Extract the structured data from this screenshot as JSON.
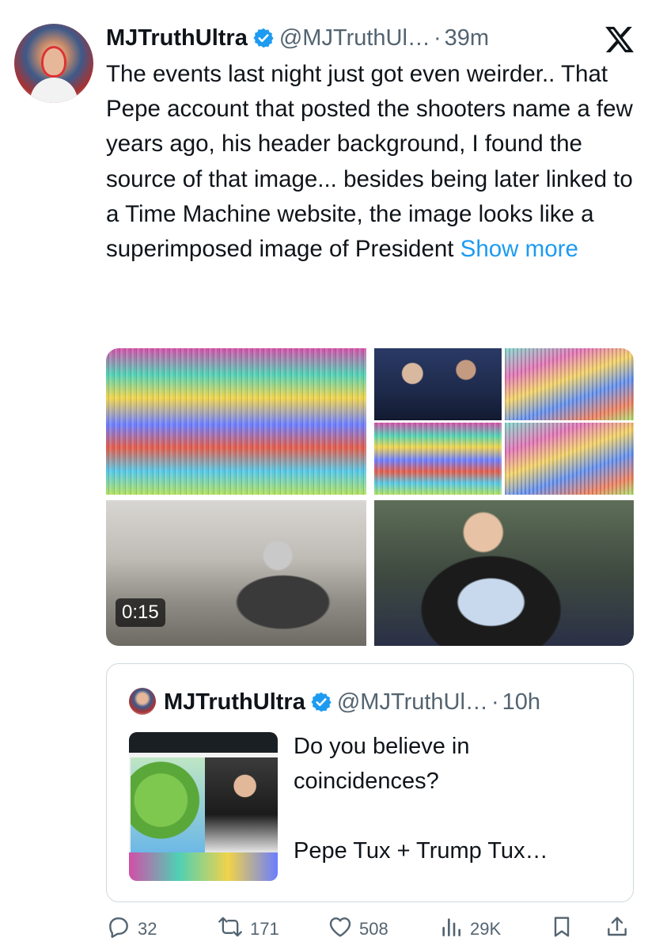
{
  "tweet": {
    "author_name": "MJTruthUltra",
    "handle": "@MJTruthUl…",
    "separator": "·",
    "time": "39m",
    "text": "The events last night just got even weirder.. That Pepe account that posted the shooters name a few years ago, his header background, I found the source of that image... besides being later linked to a Time Machine website, the image looks like a superimposed image of President ",
    "show_more": "Show more",
    "video_duration": "0:15"
  },
  "quote": {
    "author_name": "MJTruthUltra",
    "handle": "@MJTruthUl…",
    "separator": "·",
    "time": "10h",
    "text": "Do you believe in coincidences?\n\nPepe Tux + Trump Tux…"
  },
  "actions": {
    "replies": "32",
    "reposts": "171",
    "likes": "508",
    "views": "29K"
  },
  "colors": {
    "text": "#0f1419",
    "secondary": "#536471",
    "accent": "#1d9bf0",
    "border": "#cfd9de"
  },
  "icons": [
    "x-logo-icon",
    "verified-badge-icon",
    "reply-icon",
    "repost-icon",
    "like-icon",
    "views-icon",
    "bookmark-icon",
    "share-icon"
  ]
}
